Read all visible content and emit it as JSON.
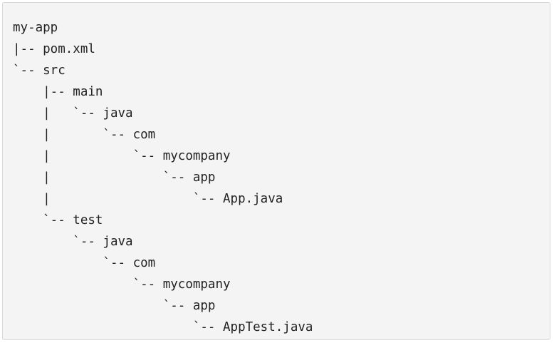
{
  "tree_lines": [
    "my-app",
    "|-- pom.xml",
    "`-- src",
    "    |-- main",
    "    |   `-- java",
    "    |       `-- com",
    "    |           `-- mycompany",
    "    |               `-- app",
    "    |                   `-- App.java",
    "    `-- test",
    "        `-- java",
    "            `-- com",
    "                `-- mycompany",
    "                    `-- app",
    "                        `-- AppTest.java"
  ]
}
